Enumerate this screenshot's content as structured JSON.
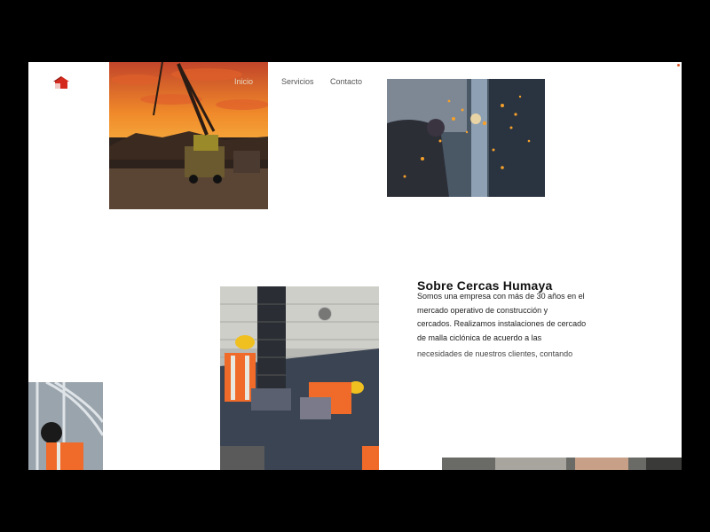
{
  "nav": {
    "items": [
      {
        "label": "Inicio"
      },
      {
        "label": "Servicios"
      },
      {
        "label": "Contacto"
      }
    ]
  },
  "logo": {
    "icon": "house-icon",
    "color": "#d42a1e"
  },
  "about": {
    "title": "Sobre Cercas Humaya",
    "lines": [
      "Somos una empresa con más de 30 años en el",
      "mercado operativo de construcción y",
      "cercados. Realizamos instalaciones de cercado",
      "de malla ciclónica de acuerdo a las",
      "necesidades de nuestros clientes, contando"
    ]
  },
  "colors": {
    "accent": "#e05a2a",
    "background": "#ffffff",
    "frame": "#000000"
  }
}
